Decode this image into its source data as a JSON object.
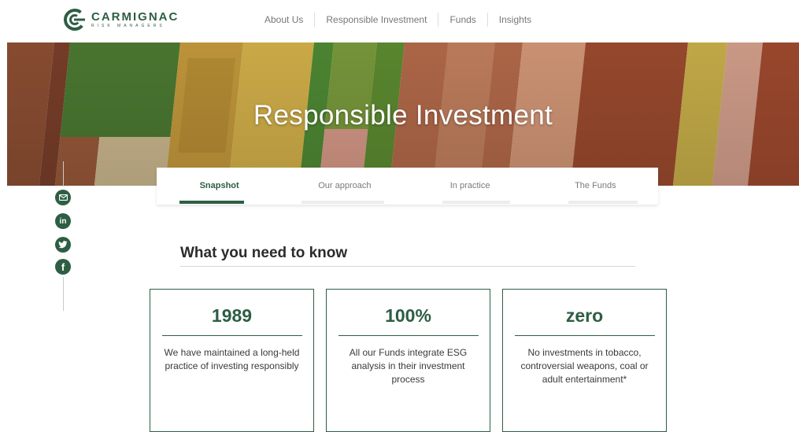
{
  "brand": {
    "name": "CARMIGNAC",
    "tagline": "RISK MANAGERS"
  },
  "nav": [
    "About Us",
    "Responsible Investment",
    "Funds",
    "Insights"
  ],
  "hero": {
    "title": "Responsible Investment"
  },
  "social": [
    "email-icon",
    "linkedin-icon",
    "twitter-icon",
    "facebook-icon"
  ],
  "tabs": [
    "Snapshot",
    "Our approach",
    "In practice",
    "The Funds"
  ],
  "section": {
    "title": "What you need to know"
  },
  "cards": [
    {
      "number": "1989",
      "text": "We have maintained a long-held practice of investing responsibly"
    },
    {
      "number": "100%",
      "text": "All our Funds integrate ESG analysis in their investment process"
    },
    {
      "number": "zero",
      "text": "No investments in tobacco, controversial weapons, coal or adult entertainment*"
    }
  ],
  "colors": {
    "brand_green": "#2d5e44"
  }
}
